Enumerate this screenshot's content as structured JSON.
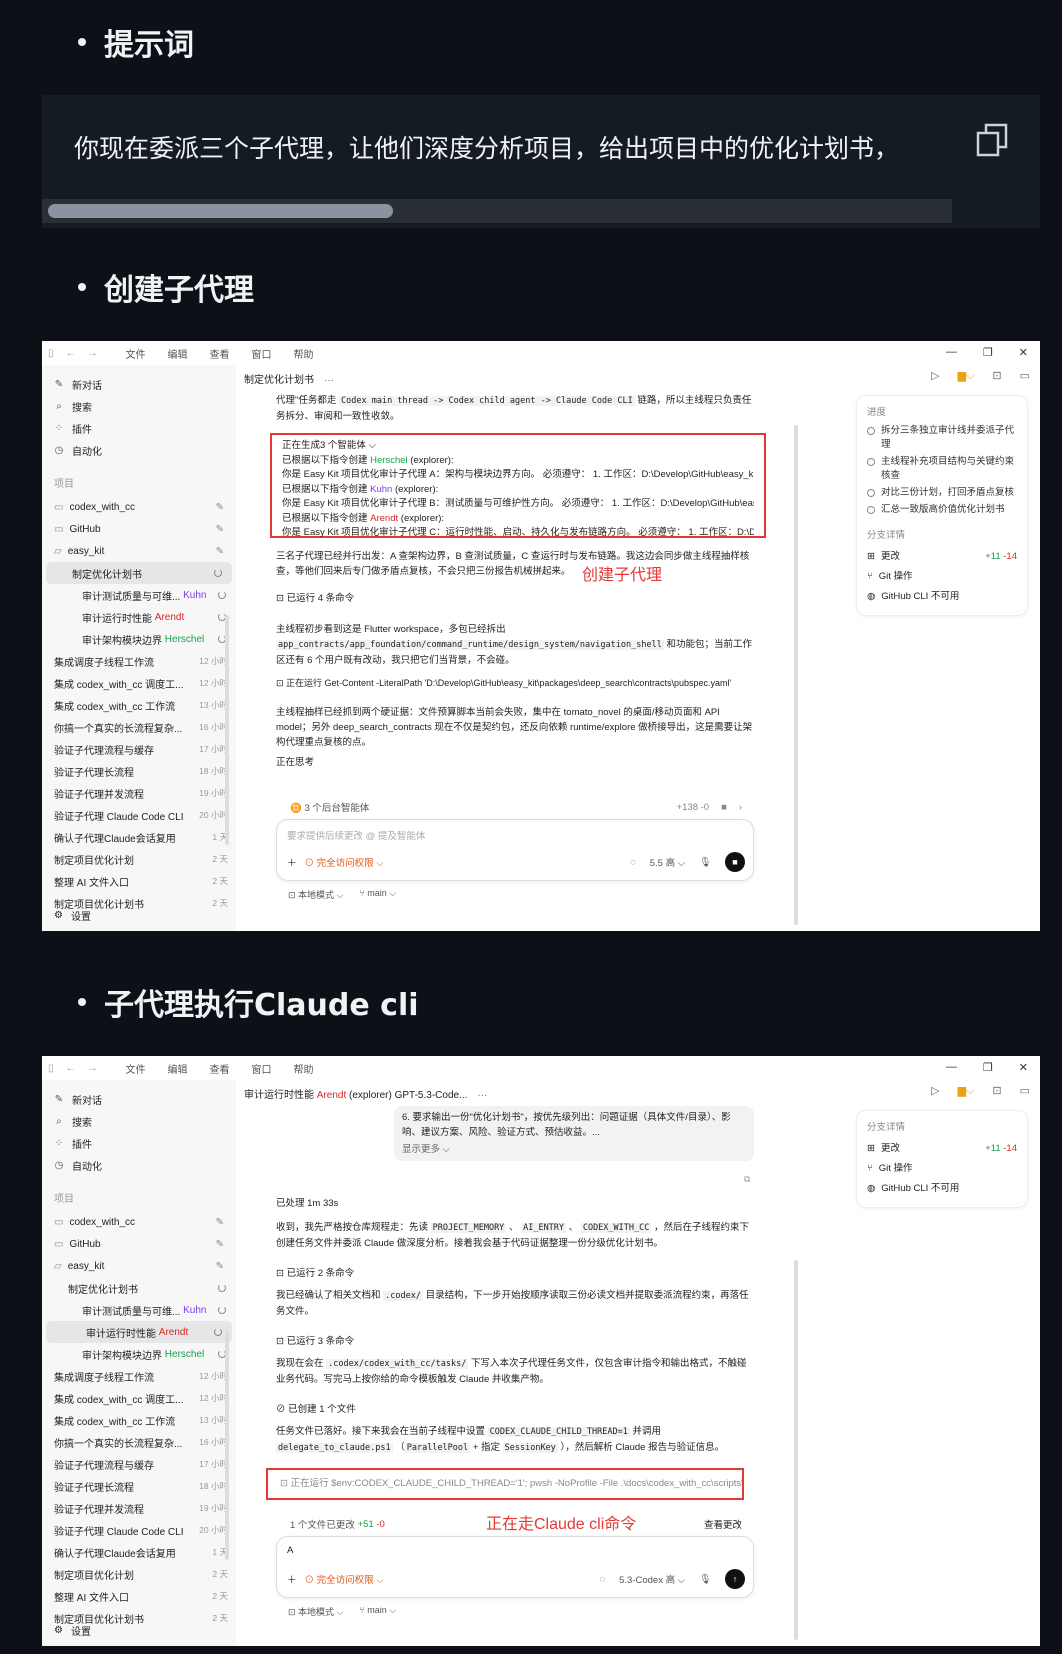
{
  "headings": {
    "prompt": "提示词",
    "create": "创建子代理",
    "exec": "子代理执行Claude cli"
  },
  "prompt_code": "你现在委派三个子代理，让他们深度分析项目，给出项目中的优化计划书，",
  "menu": [
    "文件",
    "编辑",
    "查看",
    "窗口",
    "帮助"
  ],
  "sidebar": {
    "top": [
      {
        "icon": "✎",
        "label": "新对话"
      },
      {
        "icon": "⌕",
        "label": "搜索"
      },
      {
        "icon": "⁘",
        "label": "插件"
      },
      {
        "icon": "◷",
        "label": "自动化"
      }
    ],
    "section": "项目",
    "projects": [
      "codex_with_cc",
      "GitHub",
      "easy_kit"
    ],
    "plan": "制定优化计划书",
    "subs": [
      {
        "label": "审计测试质量与可维...",
        "agent": "Kuhn"
      },
      {
        "label": "审计运行时性能",
        "agent": "Arendt"
      },
      {
        "label": "审计架构模块边界",
        "agent": "Herschel"
      }
    ],
    "history": [
      {
        "label": "集成调度子线程工作流",
        "time": "12 小时"
      },
      {
        "label": "集成 codex_with_cc 调度工...",
        "time": "12 小时"
      },
      {
        "label": "集成 codex_with_cc 工作流",
        "time": "13 小时"
      },
      {
        "label": "你搞一个真实的长流程复杂...",
        "time": "16 小时"
      },
      {
        "label": "验证子代理流程与缓存",
        "time": "17 小时"
      },
      {
        "label": "验证子代理长流程",
        "time": "18 小时"
      },
      {
        "label": "验证子代理并发流程",
        "time": "19 小时"
      },
      {
        "label": "验证子代理 Claude Code CLI",
        "time": "20 小时"
      },
      {
        "label": "确认子代理Claude会话复用",
        "time": "1 天"
      },
      {
        "label": "制定项目优化计划",
        "time": "2 天"
      },
      {
        "label": "整理 AI 文件入口",
        "time": "2 天"
      },
      {
        "label": "制定项目优化计划书",
        "time": "2 天"
      }
    ],
    "settings": "设置"
  },
  "s1": {
    "title": "制定优化计划书",
    "intro1": "代理\"任务都走",
    "intro_code": "Codex main thread -> Codex child agent -> Claude Code CLI",
    "intro2": "链路，所以主线程只负责任务拆分、审阅和一致性收敛。",
    "gen_label": "正在生成3 个智能体 ⌵",
    "agents": [
      {
        "pre": "已根据以下指令创建 ",
        "name": "Herschel",
        "post": " (explorer):",
        "desc": "你是 Easy Kit 项目优化审计子代理 A：架构与模块边界方向。 必须遵守： 1. 工作区：D:\\Develop\\GitHub\\easy_kit。 2...."
      },
      {
        "pre": "已根据以下指令创建 ",
        "name": "Kuhn",
        "post": " (explorer):",
        "desc": "你是 Easy Kit 项目优化审计子代理 B：测试质量与可维护性方向。 必须遵守： 1. 工作区：D:\\Develop\\GitHub\\easy_kit..."
      },
      {
        "pre": "已根据以下指令创建 ",
        "name": "Arendt",
        "post": " (explorer):",
        "desc": "你是 Easy Kit 项目优化审计子代理 C：运行时性能、启动、持久化与发布链路方向。 必须遵守： 1. 工作区：D:\\Develo..."
      }
    ],
    "p1": "三名子代理已经并行出发：A 查架构边界，B 查测试质量，C 查运行时与发布链路。我这边会同步做主线程抽样核查，等他们回来后专门做矛盾点复核，不会只把三份报告机械拼起来。",
    "annotation": "创建子代理",
    "ran4": "⊡ 已运行 4 条命令",
    "p2a": "主线程初步看到这是 Flutter workspace，多包已经拆出",
    "p2code": "app_contracts/app_foundation/command_runtime/design_system/navigation_shell",
    "p2b": "和功能包；当前工作区还有 6 个用户既有改动，我只把它们当背景，不会碰。",
    "running": "⊡ 正在运行 Get-Content -LiteralPath 'D:\\Develop\\GitHub\\easy_kit\\packages\\deep_search\\contracts\\pubspec.yaml'",
    "p3": "主线程抽样已经抓到两个硬证据：文件预算脚本当前会失败，集中在 tomato_novel 的桌面/移动页面和 API model；另外 deep_search_contracts 现在不仅是契约包，还反向依赖 runtime/explore 做桥接导出，这是需要让架构代理重点复核的点。",
    "thinking": "正在思考",
    "agentbar": "♊ 3 个后台智能体",
    "agentbar_diff": "+138 -0",
    "input_ph": "要求提供后续更改 @ 提及智能体",
    "perm": "⊙ 完全访问权限 ⌵",
    "model": "5.5 高 ⌵",
    "progress_title": "进度",
    "steps": [
      "拆分三条独立审计线并委派子代理",
      "主线程补充项目结构与关键约束核查",
      "对比三份计划，打回矛盾点复核",
      "汇总一致版高价值优化计划书"
    ],
    "branch_title": "分支详情",
    "changes": "更改",
    "plus": "+11",
    "minus": "-14",
    "git": "Git 操作",
    "ghcli": "GitHub CLI 不可用",
    "mode": "⊡ 本地模式 ⌵",
    "branch": "⑂ main ⌵"
  },
  "s2": {
    "title_pre": "审计运行时性能 ",
    "title_agent": "Arendt",
    "title_post": " (explorer) GPT-5.3-Code...",
    "bubble1": "6. 要求输出一份\"优化计划书\"，按优先级列出：问题证据（具体文件/目录）、影响、建议方案、风险、验证方式、预估收益。...",
    "more": "显示更多 ⌵",
    "done": "已处理 1m 33s",
    "p1a": "收到，我先严格按仓库规程走：先读",
    "p1c1": "PROJECT_MEMORY",
    "p1c2": "AI_ENTRY",
    "p1c3": "CODEX_WITH_CC",
    "p1b": "，然后在子线程约束下创建任务文件并委派 Claude 做深度分析。接着我会基于代码证据整理一份分级优化计划书。",
    "ran2": "⊡ 已运行 2 条命令",
    "p2a": "我已经确认了相关文档和",
    "p2code": ".codex/",
    "p2b": "目录结构，下一步开始按顺序读取三份必读文档并提取委派流程约束，再落任务文件。",
    "ran3": "⊡ 已运行 3 条命令",
    "p3a": "我现在会在",
    "p3code": ".codex/codex_with_cc/tasks/",
    "p3b": "下写入本次子代理任务文件，仅包含审计指令和输出格式，不触碰业务代码。写完马上按你给的命令模板触发 Claude 并收集产物。",
    "created": "⊘ 已创建 1 个文件",
    "p4a": "任务文件已落好。接下来我会在当前子线程中设置",
    "p4c1": "CODEX_CLAUDE_CHILD_THREAD=1",
    "p4b": "并调用",
    "p4c2": "delegate_to_claude.ps1",
    "p4c3": "ParallelPool",
    "p4d": "+ 指定",
    "p4c4": "SessionKey",
    "p4e": "），然后解析 Claude 报告与验证信息。",
    "running": "⊡ 正在运行 $env:CODEX_CLAUDE_CHILD_THREAD='1'; pwsh -NoProfile -File .\\docs\\codex_with_cc\\scripts\\delega",
    "annotation": "正在走Claude cli命令",
    "filebar": "1 个文件已更改",
    "filebar_plus": "+51",
    "filebar_minus": "-0",
    "review": "查看更改",
    "input_val": "A",
    "model": "5.3-Codex 高 ⌵",
    "branch_title": "分支详情"
  }
}
